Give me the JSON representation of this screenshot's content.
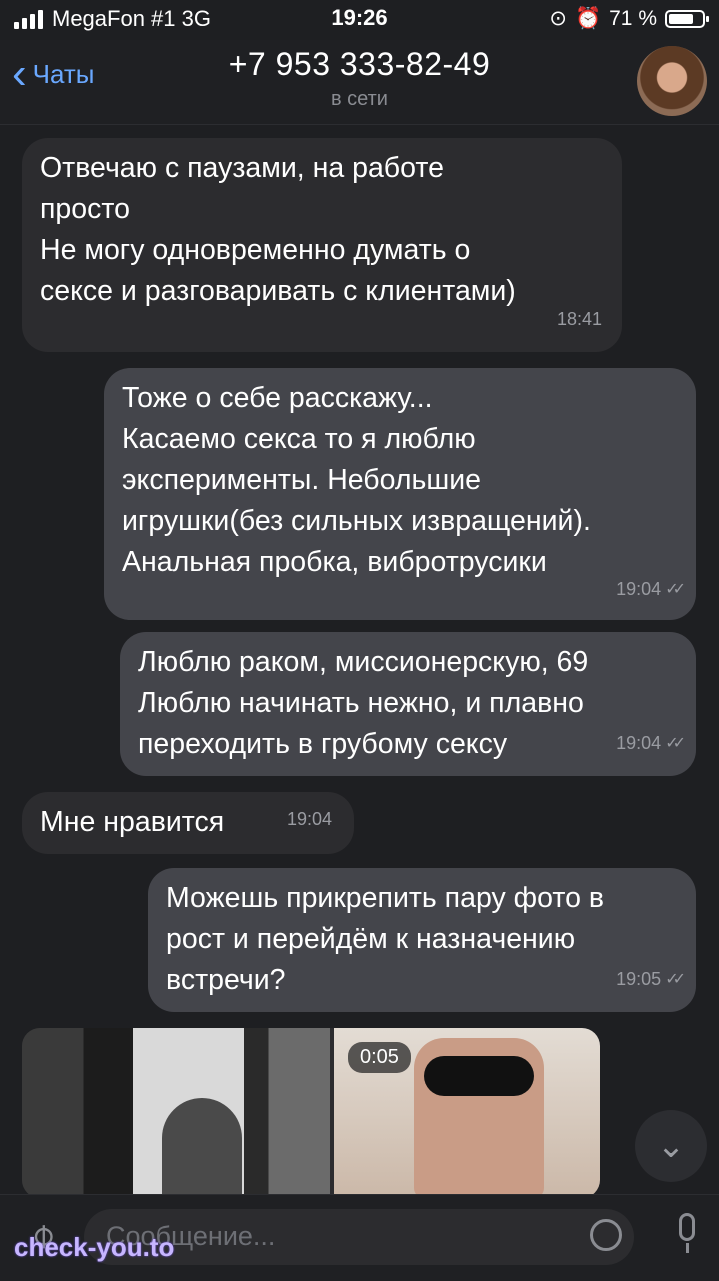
{
  "status": {
    "carrier": "MegaFon #1  3G",
    "time": "19:26",
    "battery": "71 %"
  },
  "header": {
    "back_label": "Чаты",
    "title": "+7 953 333-82-49",
    "subtitle": "в сети"
  },
  "messages": [
    {
      "direction": "incoming",
      "lines": [
        "Отвечаю с паузами, на работе",
        "просто",
        "Не могу одновременно думать о",
        "сексе и разговаривать с клиентами)"
      ],
      "time": "18:41"
    },
    {
      "direction": "outgoing",
      "lines": [
        "Тоже о себе расскажу...",
        "Касаемо секса то я люблю",
        "эксперименты. Небольшие",
        "игрушки(без сильных извращений).",
        "Анальная пробка, вибротрусики"
      ],
      "time": "19:04"
    },
    {
      "direction": "outgoing",
      "lines": [
        "Люблю раком, миссионерскую, 69",
        "Люблю начинать нежно, и плавно",
        "переходить в грубому сексу"
      ],
      "time": "19:04"
    },
    {
      "direction": "incoming",
      "lines": [
        "Мне нравится"
      ],
      "time": "19:04"
    },
    {
      "direction": "outgoing",
      "lines": [
        "Можешь прикрепить пару фото в",
        "рост и перейдём к назначению",
        "встречи?"
      ],
      "time": "19:05"
    }
  ],
  "media": {
    "video_duration": "0:05"
  },
  "input": {
    "placeholder": "Сообщение..."
  },
  "watermark": "check-you.to"
}
